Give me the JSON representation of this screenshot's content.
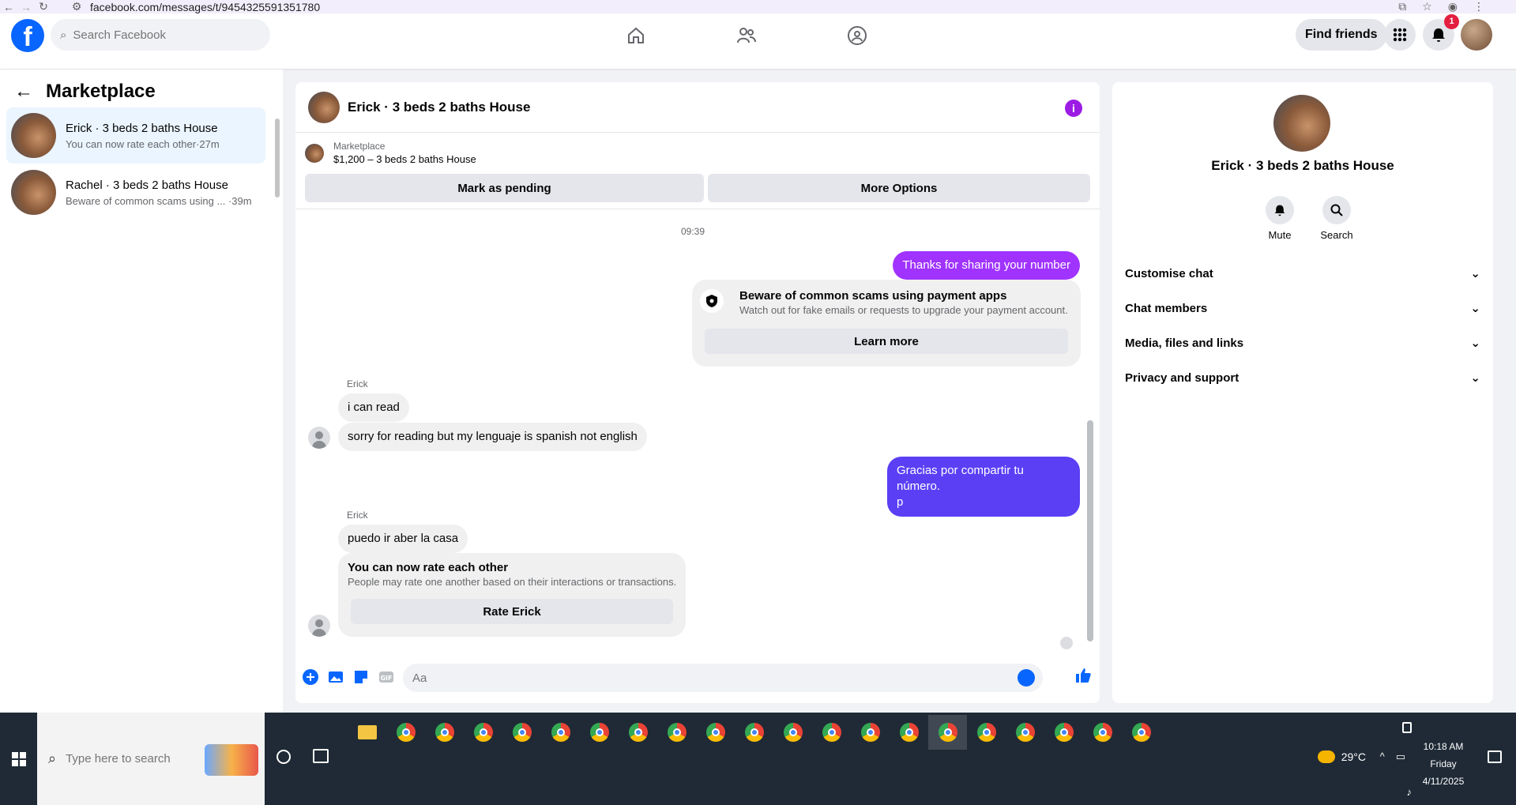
{
  "browser": {
    "url": "facebook.com/messages/t/9454325591351780"
  },
  "header": {
    "search_placeholder": "Search Facebook",
    "find_friends": "Find friends",
    "notification_count": "1",
    "brand_color": "#0866ff"
  },
  "sidebar": {
    "title": "Marketplace",
    "conversations": [
      {
        "name": "Erick · 3 beds 2 baths House",
        "preview": "You can now rate each other",
        "time": "·27m"
      },
      {
        "name": "Rachel · 3 beds 2 baths House",
        "preview": "Beware of common scams using ...",
        "time": "·39m"
      }
    ]
  },
  "chat": {
    "title": "Erick · 3 beds 2 baths House",
    "listing_source": "Marketplace",
    "listing_title": "$1,200 – 3 beds 2 baths House",
    "mark_pending": "Mark as pending",
    "more_options": "More Options",
    "timestamp": "09:39",
    "messages": {
      "out1": "Thanks for sharing your number",
      "scam_title": "Beware of common scams using payment apps",
      "scam_desc": "Watch out for fake emails or requests to upgrade your payment account.",
      "learn_more": "Learn more",
      "sender1": "Erick",
      "in1": "i can read",
      "in2": "sorry for reading but my lenguaje is spanish not english",
      "out2_line1": "Gracias por compartir tu número.",
      "out2_line2": "p",
      "sender2": "Erick",
      "in3": "puedo ir aber la casa",
      "rate_title": "You can now rate each other",
      "rate_desc": "People may rate one another based on their interactions or transactions.",
      "rate_button": "Rate Erick"
    },
    "composer_placeholder": "Aa",
    "outgoing_color": "#a033ff",
    "outgoing_color2": "#5b3ff5"
  },
  "right_panel": {
    "name": "Erick · 3 beds 2 baths House",
    "mute": "Mute",
    "search": "Search",
    "sections": [
      "Customise chat",
      "Chat members",
      "Media, files and links",
      "Privacy and support"
    ]
  },
  "taskbar": {
    "search_placeholder": "Type here to search",
    "temperature": "29°C",
    "time": "10:18 AM",
    "day": "Friday",
    "date": "4/11/2025"
  }
}
